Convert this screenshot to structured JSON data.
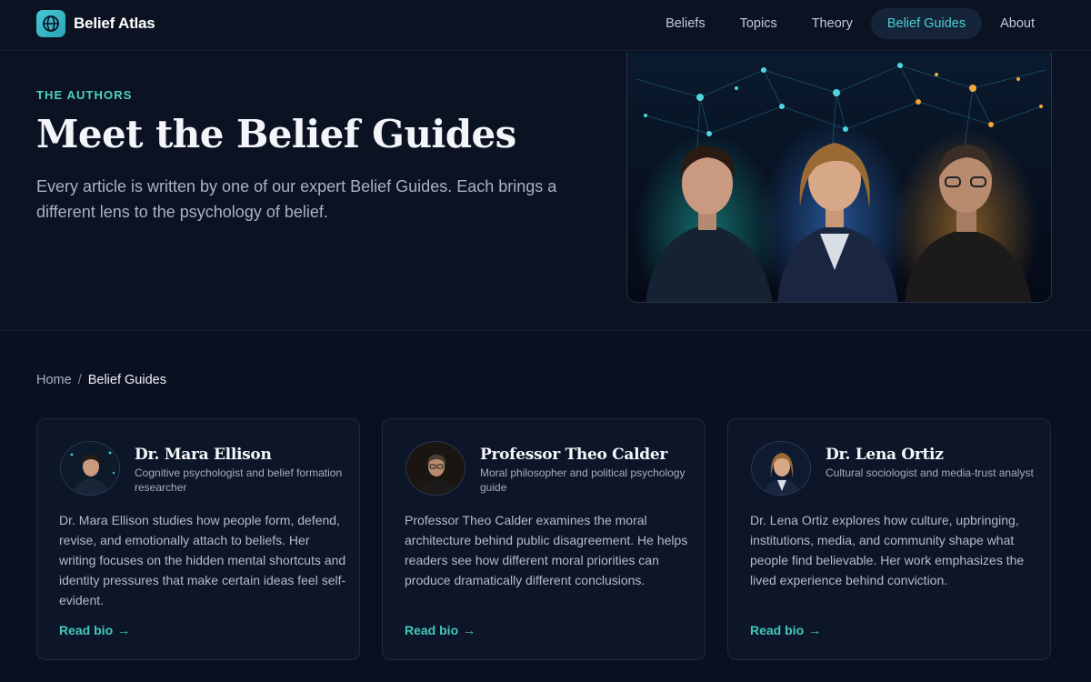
{
  "brand": {
    "name": "Belief Atlas",
    "icon": "globe-icon",
    "accent": "#48c8d6"
  },
  "nav": {
    "items": [
      {
        "label": "Beliefs",
        "active": false
      },
      {
        "label": "Topics",
        "active": false
      },
      {
        "label": "Theory",
        "active": false
      },
      {
        "label": "Belief Guides",
        "active": true
      },
      {
        "label": "About",
        "active": false
      }
    ]
  },
  "hero": {
    "eyebrow": "THE AUTHORS",
    "title": "Meet the Belief Guides",
    "subtitle": "Every article is written by one of our expert Belief Guides. Each brings a different lens to the psychology of belief."
  },
  "breadcrumb": {
    "home": "Home",
    "separator": "/",
    "current": "Belief Guides"
  },
  "guides": [
    {
      "name": "Dr. Mara Ellison",
      "role": "Cognitive psychologist and belief formation researcher",
      "bio": "Dr. Mara Ellison studies how people form, defend, revise, and emotionally attach to beliefs. Her writing focuses on the hidden mental shortcuts and identity pressures that make certain ideas feel self-evident.",
      "link": "Read bio",
      "link_icon": "arrow-right-icon"
    },
    {
      "name": "Professor Theo Calder",
      "role": "Moral philosopher and political psychology guide",
      "bio": "Professor Theo Calder examines the moral architecture behind public disagreement. He helps readers see how different moral priorities can produce dramatically different conclusions.",
      "link": "Read bio",
      "link_icon": "arrow-right-icon"
    },
    {
      "name": "Dr. Lena Ortiz",
      "role": "Cultural sociologist and media-trust analyst",
      "bio": "Dr. Lena Ortiz explores how culture, upbringing, institutions, media, and community shape what people find believable. Her work emphasizes the lived experience behind conviction.",
      "link": "Read bio",
      "link_icon": "arrow-right-icon"
    }
  ],
  "colors": {
    "background": "#0a1020",
    "accent_teal": "#4fd1c5",
    "card": "#0d1628"
  }
}
